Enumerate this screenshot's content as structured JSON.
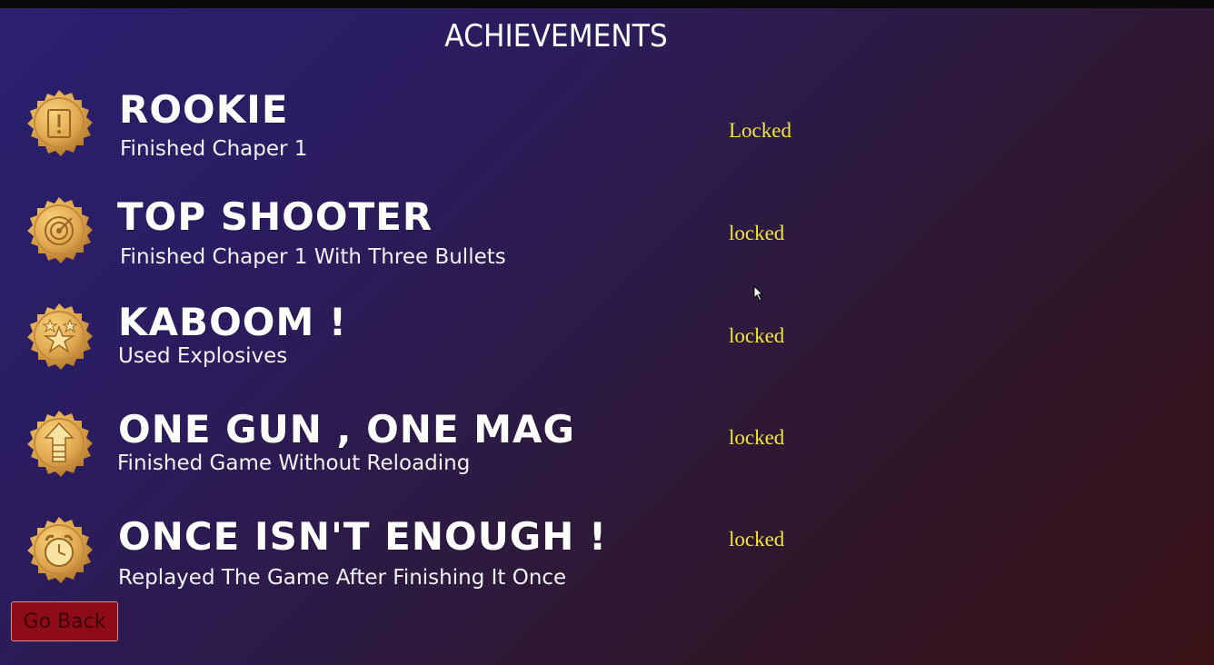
{
  "screen": {
    "title": "ACHIEVEMENTS"
  },
  "achievements": [
    {
      "name": "ROOKIE",
      "description": "Finished Chaper 1",
      "status": "Locked",
      "icon": "book-exclamation-icon"
    },
    {
      "name": "TOP SHOOTER",
      "description": "Finished Chaper 1 With Three Bullets",
      "status": "locked",
      "icon": "target-icon"
    },
    {
      "name": "KABOOM !",
      "description": "Used Explosives",
      "status": "locked",
      "icon": "stars-icon"
    },
    {
      "name": "ONE GUN , ONE MAG",
      "description": "Finished Game Without Reloading",
      "status": "locked",
      "icon": "arrow-up-icon"
    },
    {
      "name": "ONCE ISN'T ENOUGH !",
      "description": "Replayed The Game After Finishing It Once",
      "status": "locked",
      "icon": "alarm-clock-icon"
    }
  ],
  "footer": {
    "go_back_label": "Go Back"
  },
  "colors": {
    "status": "#f0e53a",
    "medal_gold": "#e0a850",
    "button": "#8e0c17"
  }
}
